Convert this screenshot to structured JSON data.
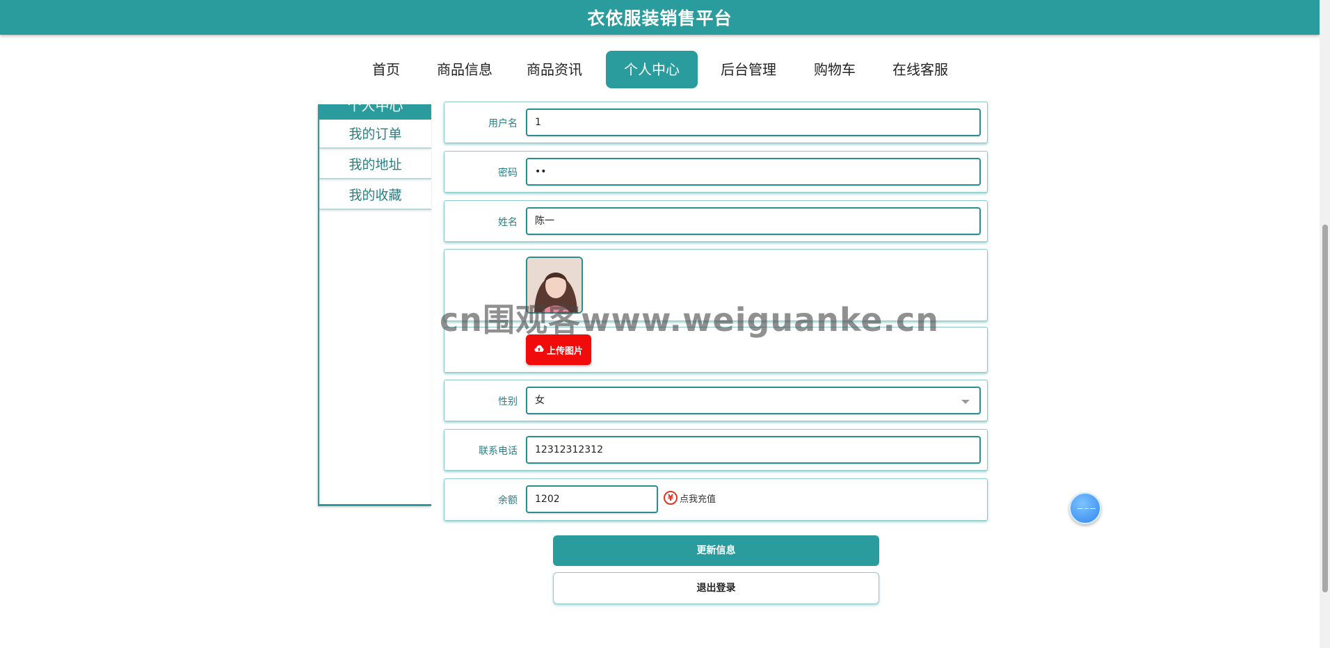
{
  "header": {
    "title": "衣依服装销售平台"
  },
  "nav": {
    "items": [
      {
        "label": "首页"
      },
      {
        "label": "商品信息"
      },
      {
        "label": "商品资讯"
      },
      {
        "label": "个人中心"
      },
      {
        "label": "后台管理"
      },
      {
        "label": "购物车"
      },
      {
        "label": "在线客服"
      }
    ],
    "active": "个人中心"
  },
  "sidebar": {
    "header": "个人中心",
    "items": [
      {
        "label": "我的订单"
      },
      {
        "label": "我的地址"
      },
      {
        "label": "我的收藏"
      }
    ]
  },
  "form": {
    "username": {
      "label": "用户名",
      "value": "1"
    },
    "password": {
      "label": "密码",
      "value": "••"
    },
    "name": {
      "label": "姓名",
      "value": "陈一"
    },
    "upload_label": "上传图片",
    "gender": {
      "label": "性别",
      "value": "女"
    },
    "phone": {
      "label": "联系电话",
      "value": "12312312312"
    },
    "balance": {
      "label": "余额",
      "value": "1202",
      "recharge_label": "点我充值"
    }
  },
  "buttons": {
    "update": "更新信息",
    "logout": "退出登录"
  },
  "watermark": "cn围观客www.weiguanke.cn",
  "colors": {
    "primary": "#2a9c9e",
    "upload": "#f20b0b",
    "recharge_icon": "#dd3322"
  },
  "icons": {
    "upload": "cloud-upload-icon",
    "recharge": "yen-icon",
    "float": "chat-bubble-icon",
    "select": "chevron-down-icon"
  }
}
